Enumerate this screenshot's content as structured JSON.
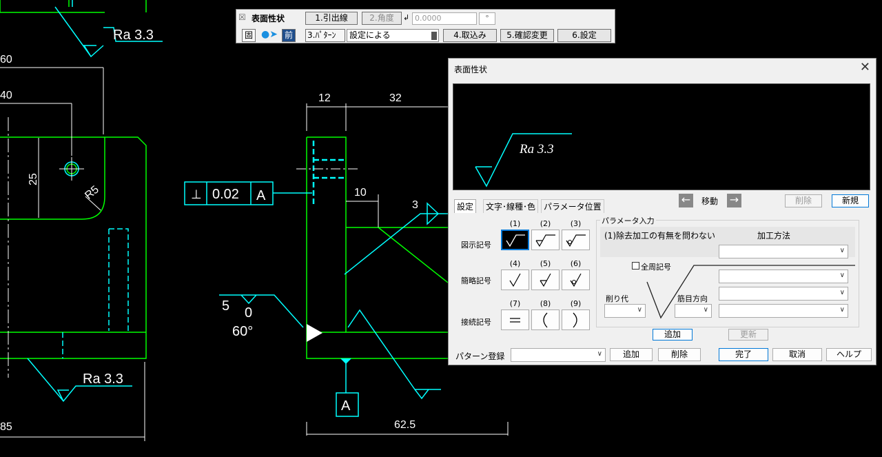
{
  "cad": {
    "roughness_top": "Ra 3.3",
    "roughness_bottom": "Ra 3.3",
    "dim_60": "60",
    "dim_40": "40",
    "dim_25": "25",
    "dim_r5": "R5",
    "dim_85": "85",
    "dim_12": "12",
    "dim_32": "32",
    "dim_10": "10",
    "dim_3": "3",
    "dim_625": "62.5",
    "tol_perp": "⊥",
    "tol_value": "0.02",
    "tol_datum": "A",
    "datum_label": "A",
    "weld_5": "5",
    "weld_0": "0",
    "weld_60": "60°"
  },
  "toolbar": {
    "title": "表面性状",
    "leader_btn": "1.引出線",
    "angle_btn": "2.角度",
    "angle_value": "0.0000",
    "angle_unit": "°",
    "icon_btn": "固",
    "prev_btn": "前",
    "pattern_btn": "3.ﾊﾟﾀｰﾝ",
    "pattern_value": "設定による",
    "import_btn": "4.取込み",
    "confirm_btn": "5.確認変更",
    "settings_btn": "6.設定"
  },
  "dialog": {
    "title": "表面性状",
    "preview_text": "Ra 3.3",
    "move_label": "移動",
    "delete_btn": "削除",
    "new_btn": "新規",
    "tabs": [
      "設定",
      "文字･線種･色",
      "パラメータ位置"
    ],
    "row_labels": [
      "図示記号",
      "簡略記号",
      "接続記号"
    ],
    "symbol_numbers": [
      "(1)",
      "(2)",
      "(3)",
      "(4)",
      "(5)",
      "(6)",
      "(7)",
      "(8)",
      "(9)"
    ],
    "param_group": "パラメータ入力",
    "param_caption": "(1)除去加工の有無を問わない",
    "machining_label": "加工方法",
    "all_around_label": "全周記号",
    "allowance_label": "削り代",
    "lay_label": "筋目方向",
    "add_btn": "追加",
    "update_btn": "更新",
    "pattern_label": "パターン登録",
    "pattern_add_btn": "追加",
    "pattern_delete_btn": "削除",
    "done_btn": "完了",
    "cancel_btn": "取消",
    "help_btn": "ヘルプ"
  }
}
